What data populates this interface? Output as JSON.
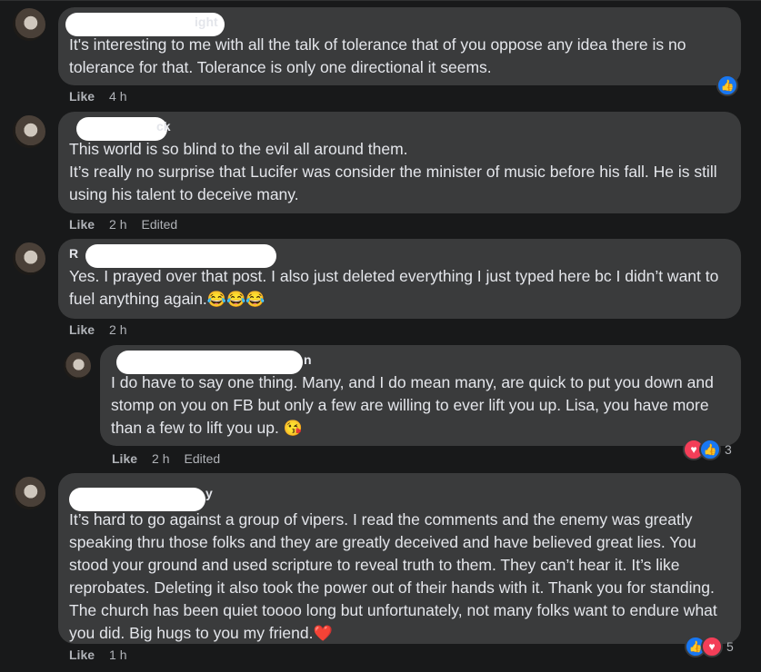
{
  "comments": [
    {
      "name": "ight",
      "text": "It's interesting to me with all the talk of tolerance that of you oppose any idea there is no tolerance for that. Tolerance is only one directional it seems.",
      "like": "Like",
      "time": "4 h",
      "edited": "",
      "reaction_count": ""
    },
    {
      "name": "ck",
      "text1": "This world is so blind to the evil all around them.",
      "text2": "It’s really no surprise that Lucifer was consider the minister of music before his fall. He is still using his talent to deceive many.",
      "like": "Like",
      "time": "2 h",
      "edited": "Edited"
    },
    {
      "name": "R",
      "text": "Yes. I prayed over that post. I also just deleted everything I just typed here bc I didn’t want to fuel anything again.",
      "emoji": "😂😂😂",
      "like": "Like",
      "time": "2 h",
      "edited": ""
    },
    {
      "name": "n",
      "text": "I do have to say one thing. Many, and I do mean many, are quick to put you down and stomp on you on FB but only a few are willing to ever lift you up. Lisa, you have more than a few to lift you up.",
      "emoji": "😘",
      "like": "Like",
      "time": "2 h",
      "edited": "Edited",
      "reaction_count": "3"
    },
    {
      "name": "y",
      "text": "It’s hard to go against a group of vipers. I read the comments and the enemy was greatly speaking thru those folks and they are greatly deceived and have believed great lies. You stood your ground and used scripture to reveal truth to them. They can’t hear it. It’s like reprobates. Deleting it also took the power out of their hands with it. Thank you for standing. The church has been quiet toooo long but unfortunately, not many folks want to endure what you did. Big hugs to you my friend.",
      "emoji": "❤️",
      "like": "Like",
      "time": "1 h",
      "edited": "",
      "reaction_count": "5"
    }
  ],
  "icons": {
    "like": "thumbs-up",
    "love": "heart"
  },
  "colors": {
    "background": "#18191a",
    "bubble": "#3a3b3c",
    "like_blue": "#1877f2",
    "love_red": "#f33e58"
  }
}
